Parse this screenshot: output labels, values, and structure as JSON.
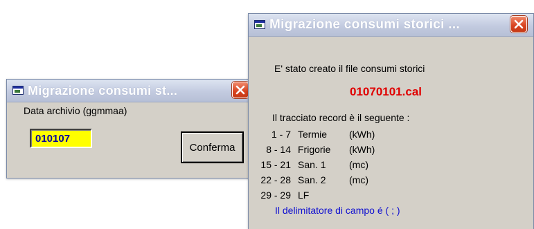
{
  "dialog_input": {
    "title": "Migrazione consumi st...",
    "field_label": "Data archivio (ggmmaa)",
    "field_value": "010107",
    "confirm_label": "Conferma"
  },
  "dialog_info": {
    "title": "Migrazione consumi storici ...",
    "created_message": "E' stato creato il file consumi storici",
    "filename": "01070101.cal",
    "record_header": "Il tracciato record è il seguente  :",
    "records": [
      {
        "range": "1 -  7",
        "name": "Termie",
        "unit": "(kWh)"
      },
      {
        "range": "8 - 14",
        "name": "Frigorie",
        "unit": "(kWh)"
      },
      {
        "range": "15 - 21",
        "name": "San. 1",
        "unit": "(mc)"
      },
      {
        "range": "22 - 28",
        "name": "San. 2",
        "unit": "(mc)"
      },
      {
        "range": "29 - 29",
        "name": "LF",
        "unit": ""
      }
    ],
    "delimiter_note": "Il delimitatore di campo é  ( ; )"
  },
  "colors": {
    "filename": "#e00000",
    "delimiter_note": "#1010d0",
    "input_bg": "#ffff00",
    "input_text": "#0000a0",
    "window_bg": "#d4d0c8"
  },
  "icons": {
    "window": "app-window-icon",
    "close": "close-icon"
  }
}
